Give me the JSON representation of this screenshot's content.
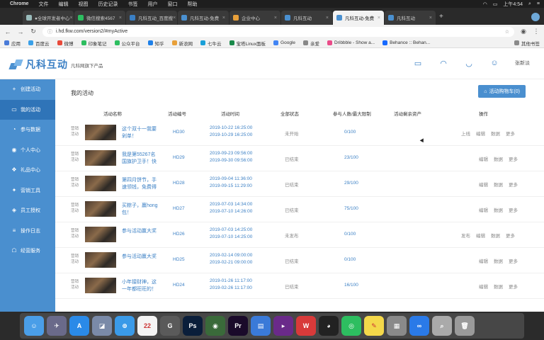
{
  "menubar": {
    "app": "Chrome",
    "items": [
      "文件",
      "编辑",
      "视图",
      "历史记录",
      "书签",
      "用户",
      "窗口",
      "帮助"
    ],
    "clock": "上午4:54"
  },
  "tabs": [
    {
      "title": "●全球开发者中心",
      "active": false
    },
    {
      "title": "微信搜索4567",
      "active": false
    },
    {
      "title": "凡科互动_百度搜",
      "active": false
    },
    {
      "title": "凡科互动-免费",
      "active": false
    },
    {
      "title": "企业中心",
      "active": false
    },
    {
      "title": "凡科互动",
      "active": false
    },
    {
      "title": "凡科互动-免费",
      "active": true
    },
    {
      "title": "凡科互动",
      "active": false
    }
  ],
  "address": {
    "url": "i.hd.fkw.com/version2/#myActive"
  },
  "bookmarks": [
    {
      "label": "应用",
      "color": "#4a7bd8"
    },
    {
      "label": "百度云",
      "color": "#3aa0e8"
    },
    {
      "label": "微博",
      "color": "#e84a3a"
    },
    {
      "label": "印象笔记",
      "color": "#2dbe60"
    },
    {
      "label": "公众平台",
      "color": "#2dbe60"
    },
    {
      "label": "知乎",
      "color": "#1e80e8"
    },
    {
      "label": "新浪网",
      "color": "#e8a03a"
    },
    {
      "label": "七牛云",
      "color": "#1aa0d8"
    },
    {
      "label": "宝塔Linux面板",
      "color": "#1a8a4a"
    },
    {
      "label": "Google",
      "color": "#4285f4"
    },
    {
      "label": "亲爱",
      "color": "#888888"
    },
    {
      "label": "Dribbble - Show a...",
      "color": "#ea4c89"
    },
    {
      "label": "Behance :: Behan...",
      "color": "#1769ff"
    }
  ],
  "bookmarks_other": "其他书签",
  "header": {
    "brand": "凡科互动",
    "tagline": "凡科网旗下产品",
    "username": "张新淡"
  },
  "sidebar": {
    "items": [
      {
        "label": "创建活动",
        "icon": "+",
        "active": false
      },
      {
        "label": "我的活动",
        "icon": "▭",
        "active": true
      },
      {
        "label": "参与数据",
        "icon": "◔",
        "active": false
      },
      {
        "label": "个人中心",
        "icon": "◉",
        "active": false
      },
      {
        "label": "礼品中心",
        "icon": "❖",
        "active": false
      },
      {
        "label": "营销工具",
        "icon": "✦",
        "active": false
      },
      {
        "label": "员工授权",
        "icon": "◈",
        "active": false
      },
      {
        "label": "操作日志",
        "icon": "≡",
        "active": false
      },
      {
        "label": "经营服务",
        "icon": "☖",
        "active": false
      }
    ]
  },
  "main": {
    "title": "我的活动",
    "cart_button": "活动购物车(0)",
    "columns": {
      "name": "活动名称",
      "code": "活动编号",
      "time": "活动时间",
      "status": "全部状态",
      "participants": "参与人数/最大限制",
      "resources": "活动剩余资产",
      "ops": "操作"
    },
    "rows": [
      {
        "type": "营销活动",
        "name": "这个双十一我要剁单！",
        "code": "HD30",
        "start": "2019-10-22 16:25:00",
        "end": "2019-10-29 16:25:00",
        "status": "未开始",
        "people": "0/100",
        "ops": [
          "上线",
          "编辑",
          "数据",
          "更多"
        ]
      },
      {
        "type": "营销活动",
        "name": "我是第55267名国旗护卫手！快",
        "code": "HD29",
        "start": "2019-09-23 09:56:00",
        "end": "2019-09-30 09:56:00",
        "status": "已结束",
        "people": "23/100",
        "ops": [
          "编辑",
          "数据",
          "更多"
        ]
      },
      {
        "type": "营销活动",
        "name": "第四月饼节，手速领钱，免费得",
        "code": "HD28",
        "start": "2019-09-04 11:36:00",
        "end": "2019-09-15 11:29:00",
        "status": "已结束",
        "people": "29/100",
        "ops": [
          "编辑",
          "数据",
          "更多"
        ]
      },
      {
        "type": "营销活动",
        "name": "买粽子，赢hong包！",
        "code": "HD27",
        "start": "2019-07-03 14:34:00",
        "end": "2019-07-10 14:26:00",
        "status": "已结束",
        "people": "75/100",
        "ops": [
          "编辑",
          "数据",
          "更多"
        ]
      },
      {
        "type": "营销活动",
        "name": "参与活动赢大奖",
        "code": "HD26",
        "start": "2019-07-03 14:25:00",
        "end": "2019-07-10 14:25:00",
        "status": "未发布",
        "people": "0/100",
        "ops": [
          "发布",
          "编辑",
          "数据",
          "更多"
        ]
      },
      {
        "type": "营销活动",
        "name": "参与活动赢大奖",
        "code": "HD25",
        "start": "2019-02-14 09:00:00",
        "end": "2019-02-21 09:00:00",
        "status": "已结束",
        "people": "0/100",
        "ops": [
          "编辑",
          "数据",
          "更多"
        ]
      },
      {
        "type": "营销活动",
        "name": "小年接财神，这一年都旺旺的！",
        "code": "HD24",
        "start": "2019-01-26 11:17:00",
        "end": "2019-02-26 11:17:00",
        "status": "已结束",
        "people": "16/100",
        "ops": [
          "编辑",
          "数据",
          "更多"
        ]
      }
    ]
  },
  "dock": {
    "apps": [
      {
        "label": "Finder",
        "glyph": "☺",
        "color": "#4a9ee8"
      },
      {
        "label": "Launchpad",
        "glyph": "✈",
        "color": "#6a6a8a"
      },
      {
        "label": "App Store",
        "glyph": "A",
        "color": "#2a8ae8"
      },
      {
        "label": "Preview",
        "glyph": "◪",
        "color": "#7a8aa8"
      },
      {
        "label": "Safari",
        "glyph": "⊕",
        "color": "#3a9ae8"
      },
      {
        "label": "Calendar",
        "glyph": "22",
        "color": "#f4f4f4"
      },
      {
        "label": "Gifox",
        "glyph": "G",
        "color": "#5a5a5a"
      },
      {
        "label": "Photoshop",
        "glyph": "Ps",
        "color": "#0a1e3a"
      },
      {
        "label": "Motion",
        "glyph": "◉",
        "color": "#3a6a3a"
      },
      {
        "label": "Premiere",
        "glyph": "Pr",
        "color": "#1a0a2a"
      },
      {
        "label": "Keynote",
        "glyph": "▤",
        "color": "#3a7ad8"
      },
      {
        "label": "Video",
        "glyph": "▸",
        "color": "#6a2a8a"
      },
      {
        "label": "WPS",
        "glyph": "W",
        "color": "#d83a3a"
      },
      {
        "label": "QQ",
        "glyph": "◕",
        "color": "#222222"
      },
      {
        "label": "WeChat",
        "glyph": "◎",
        "color": "#2dbe60"
      },
      {
        "label": "Notes",
        "glyph": "✎",
        "color": "#f4d84a"
      },
      {
        "label": "Screen",
        "glyph": "▦",
        "color": "#8a8a8a"
      },
      {
        "label": "Baidu Netdisk",
        "glyph": "∞",
        "color": "#2a7ae8"
      },
      {
        "label": "Search",
        "glyph": "⌕",
        "color": "#aaaaaa"
      },
      {
        "label": "Trash",
        "glyph": "🗑",
        "color": "#9a9a9a"
      }
    ]
  }
}
